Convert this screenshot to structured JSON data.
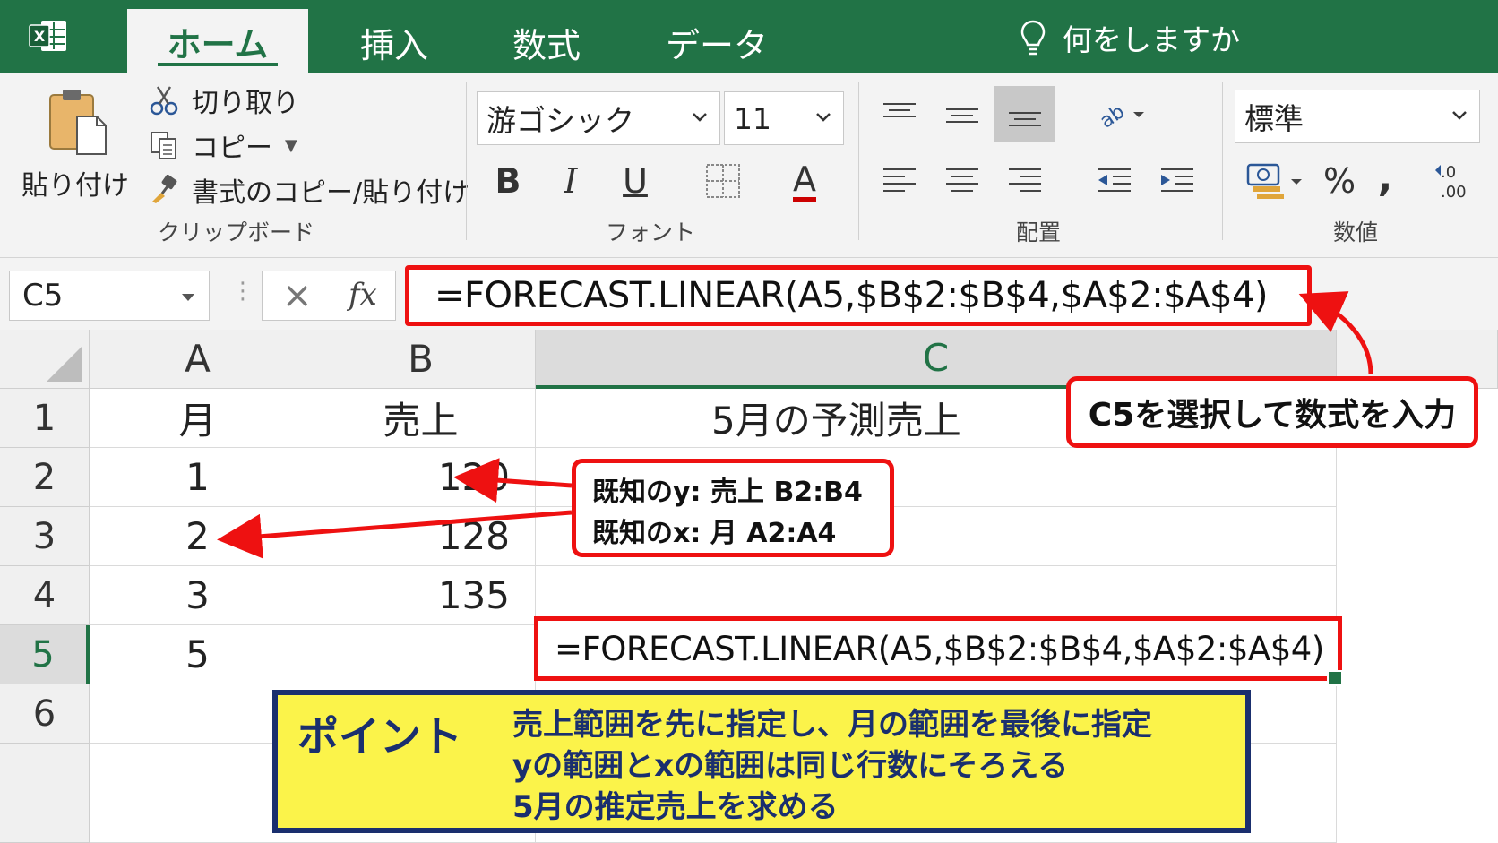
{
  "ribbon_tabs": {
    "home": "ホーム",
    "insert": "挿入",
    "formulas": "数式",
    "data": "データ"
  },
  "tell_me": "何をしますか",
  "clipboard": {
    "paste": "貼り付け",
    "cut": "切り取り",
    "copy": "コピー",
    "format_painter": "書式のコピー/貼り付け",
    "group_label": "クリップボード"
  },
  "font": {
    "name": "游ゴシック",
    "size": "11",
    "bold": "B",
    "italic": "I",
    "underline": "U",
    "font_color": "A",
    "group_label": "フォント"
  },
  "alignment": {
    "group_label": "配置"
  },
  "number": {
    "format": "標準",
    "percent": "%",
    "comma": ",",
    "decimals": "←.0\n.00",
    "group_label": "数値"
  },
  "formula_bar": {
    "name_box": "C5",
    "cancel": "×",
    "fx": "fx",
    "formula": "=FORECAST.LINEAR(A5,$B$2:$B$4,$A$2:$A$4)"
  },
  "sheet": {
    "columns": [
      "A",
      "B",
      "C"
    ],
    "rows": [
      "1",
      "2",
      "3",
      "4",
      "5",
      "6"
    ],
    "cells": {
      "A1": "月",
      "B1": "売上",
      "C1": "5月の予測売上",
      "A2": "1",
      "B2": "120",
      "A3": "2",
      "B3": "128",
      "A4": "3",
      "B4": "135",
      "A5": "5",
      "C5": "=FORECAST.LINEAR(A5,$B$2:$B$4,$A$2:$A$4)"
    }
  },
  "callouts": {
    "input_instruction": "C5を選択して数式を入力",
    "known_y": "既知のy: 売上 B2:B4",
    "known_x": "既知のx: 月 A2:A4"
  },
  "point": {
    "title": "ポイント",
    "line1": "売上範囲を先に指定し、月の範囲を最後に指定",
    "line2": "yの範囲とxの範囲は同じ行数にそろえる",
    "line3": "5月の推定売上を求める"
  },
  "colors": {
    "excel_green": "#217346",
    "callout_red": "#ee1111",
    "point_yellow": "#fbf34a",
    "point_navy": "#1a2f6e"
  }
}
